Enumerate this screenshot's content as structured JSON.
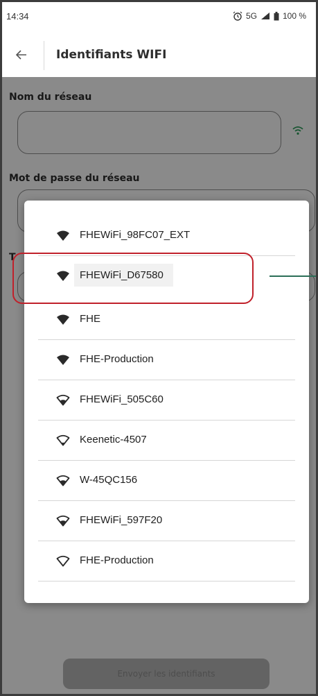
{
  "status_bar": {
    "time": "14:34",
    "network": "5G",
    "battery": "100 %"
  },
  "app_bar": {
    "title": "Identifiants WIFI",
    "back_icon": "arrow-back-icon"
  },
  "form": {
    "network_name_label": "Nom du réseau",
    "network_name_value": "",
    "password_label": "Mot de passe du réseau",
    "password_value": "",
    "third_label": "T",
    "send_button_label": "Envoyer les identifiants"
  },
  "network_dialog": {
    "networks": [
      {
        "ssid": "FHEWiFi_98FC07_EXT",
        "signal": "full"
      },
      {
        "ssid": "FHEWiFi_D67580",
        "signal": "full",
        "highlighted": true
      },
      {
        "ssid": "FHE",
        "signal": "full"
      },
      {
        "ssid": "FHE-Production",
        "signal": "full"
      },
      {
        "ssid": "FHEWiFi_505C60",
        "signal": "medium"
      },
      {
        "ssid": "Keenetic-4507",
        "signal": "low"
      },
      {
        "ssid": "W-45QC156",
        "signal": "medium"
      },
      {
        "ssid": "FHEWiFi_597F20",
        "signal": "medium"
      },
      {
        "ssid": "FHE-Production",
        "signal": "empty"
      }
    ]
  },
  "colors": {
    "accent_green": "#2e9d5b",
    "highlight_red": "#c0202a",
    "pointer_line": "#2b6e57"
  }
}
